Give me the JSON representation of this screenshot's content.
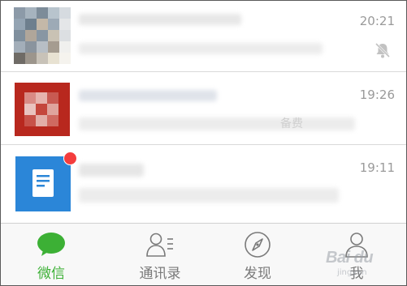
{
  "chats": [
    {
      "time": "20:21",
      "muted": true
    },
    {
      "time": "19:26",
      "visible_fragment": "备费"
    },
    {
      "time": "19:11",
      "unread_dot": true
    }
  ],
  "tabs": [
    {
      "label": "微信",
      "icon": "chat-bubble-icon",
      "active": true
    },
    {
      "label": "通讯录",
      "icon": "contacts-icon",
      "active": false
    },
    {
      "label": "发现",
      "icon": "compass-icon",
      "active": false
    },
    {
      "label": "我",
      "icon": "person-icon",
      "active": false
    }
  ],
  "colors": {
    "accent_green": "#3cb035",
    "red_dot": "#f43d3d",
    "doc_blue": "#2b86d8",
    "avatar_red": "#b8281e",
    "time_gray": "#9a9a9a"
  },
  "watermark": {
    "text": "Bai du",
    "sub": "jingyan"
  }
}
